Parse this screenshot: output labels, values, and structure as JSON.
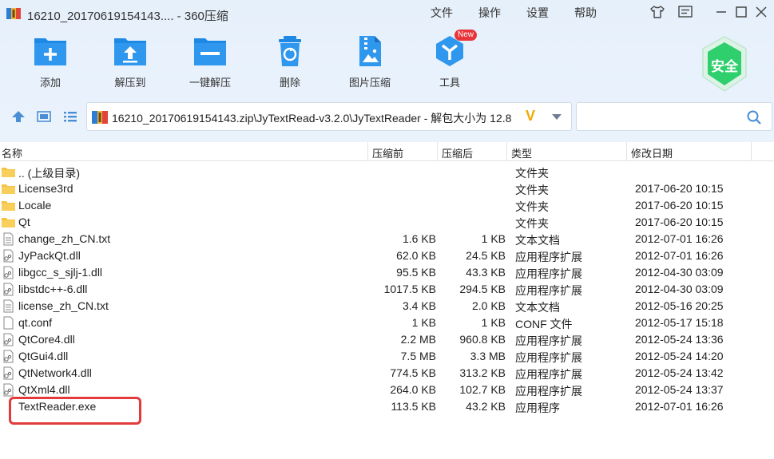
{
  "window": {
    "title": "16210_20170619154143.... - 360压缩",
    "menu": [
      "文件",
      "操作",
      "设置",
      "帮助"
    ]
  },
  "toolbar": {
    "items": [
      {
        "label": "添加",
        "icon": "add-icon"
      },
      {
        "label": "解压到",
        "icon": "extract-to-icon"
      },
      {
        "label": "一键解压",
        "icon": "one-click-extract-icon"
      },
      {
        "label": "删除",
        "icon": "delete-icon"
      },
      {
        "label": "图片压缩",
        "icon": "image-compress-icon"
      },
      {
        "label": "工具",
        "icon": "tools-icon"
      }
    ],
    "new_badge": "New",
    "security_label": "安全"
  },
  "address": {
    "path": "16210_20170619154143.zip\\JyTextRead-v3.2.0\\JyTextReader - 解包大小为 12.8",
    "v_mark": "V"
  },
  "search": {
    "placeholder": ""
  },
  "columns": [
    "名称",
    "压缩前",
    "压缩后",
    "类型",
    "修改日期"
  ],
  "files": [
    {
      "name": ".. (上级目录)",
      "size": "",
      "packed": "",
      "type": "文件夹",
      "date": "",
      "icon": "folder"
    },
    {
      "name": "License3rd",
      "size": "",
      "packed": "",
      "type": "文件夹",
      "date": "2017-06-20 10:15",
      "icon": "folder"
    },
    {
      "name": "Locale",
      "size": "",
      "packed": "",
      "type": "文件夹",
      "date": "2017-06-20 10:15",
      "icon": "folder"
    },
    {
      "name": "Qt",
      "size": "",
      "packed": "",
      "type": "文件夹",
      "date": "2017-06-20 10:15",
      "icon": "folder"
    },
    {
      "name": "change_zh_CN.txt",
      "size": "1.6 KB",
      "packed": "1 KB",
      "type": "文本文档",
      "date": "2012-07-01 16:26",
      "icon": "text"
    },
    {
      "name": "JyPackQt.dll",
      "size": "62.0 KB",
      "packed": "24.5 KB",
      "type": "应用程序扩展",
      "date": "2012-07-01 16:26",
      "icon": "dll"
    },
    {
      "name": "libgcc_s_sjlj-1.dll",
      "size": "95.5 KB",
      "packed": "43.3 KB",
      "type": "应用程序扩展",
      "date": "2012-04-30 03:09",
      "icon": "dll"
    },
    {
      "name": "libstdc++-6.dll",
      "size": "1017.5 KB",
      "packed": "294.5 KB",
      "type": "应用程序扩展",
      "date": "2012-04-30 03:09",
      "icon": "dll"
    },
    {
      "name": "license_zh_CN.txt",
      "size": "3.4 KB",
      "packed": "2.0 KB",
      "type": "文本文档",
      "date": "2012-05-16 20:25",
      "icon": "text"
    },
    {
      "name": "qt.conf",
      "size": "1 KB",
      "packed": "1 KB",
      "type": "CONF 文件",
      "date": "2012-05-17 15:18",
      "icon": "blank"
    },
    {
      "name": "QtCore4.dll",
      "size": "2.2 MB",
      "packed": "960.8 KB",
      "type": "应用程序扩展",
      "date": "2012-05-24 13:36",
      "icon": "dll"
    },
    {
      "name": "QtGui4.dll",
      "size": "7.5 MB",
      "packed": "3.3 MB",
      "type": "应用程序扩展",
      "date": "2012-05-24 14:20",
      "icon": "dll"
    },
    {
      "name": "QtNetwork4.dll",
      "size": "774.5 KB",
      "packed": "313.2 KB",
      "type": "应用程序扩展",
      "date": "2012-05-24 13:42",
      "icon": "dll"
    },
    {
      "name": "QtXml4.dll",
      "size": "264.0 KB",
      "packed": "102.7 KB",
      "type": "应用程序扩展",
      "date": "2012-05-24 13:37",
      "icon": "dll"
    },
    {
      "name": "TextReader.exe",
      "size": "113.5 KB",
      "packed": "43.2 KB",
      "type": "应用程序",
      "date": "2012-07-01 16:26",
      "icon": "none"
    }
  ],
  "colors": {
    "accent": "#1e88e5",
    "folder": "#f5c244",
    "highlight": "#e23b3b",
    "security": "#2fcf6d"
  }
}
